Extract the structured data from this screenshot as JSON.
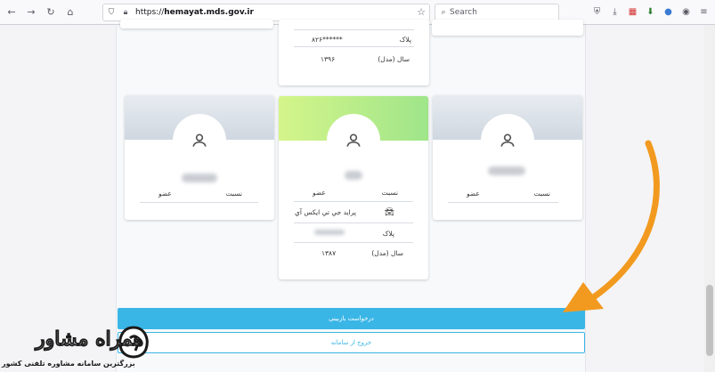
{
  "browser": {
    "url_prefix": "https://",
    "url_host": "hemayat.mds.gov.ir",
    "search_placeholder": "Search"
  },
  "top_card": {
    "plate_value": "******۸۲۶",
    "plate_label": "پلاک",
    "year_value": "۱۳۹۶",
    "year_label": "سال (مدل)"
  },
  "cards": [
    {
      "relation_label": "نسبت",
      "relation_value": "عضو"
    },
    {
      "relation_label": "نسبت",
      "relation_value": "عضو",
      "car_model": "پراید جي تي ايکس آي",
      "plate_label": "پلاک",
      "year_label": "سال (مدل)",
      "year_value": "۱۳۸۷"
    },
    {
      "relation_label": "نسبت",
      "relation_value": "عضو"
    }
  ],
  "actions": {
    "review_request": "درخواست بازبینی",
    "exit_system": "خروج از سامانه"
  },
  "watermark": {
    "title": "همراه مشاور",
    "subtitle": "بزرگترین سامانه مشاوره تلفنی کشور"
  },
  "colors": {
    "primary": "#3ab6e6",
    "arrow": "#f29a1f"
  }
}
